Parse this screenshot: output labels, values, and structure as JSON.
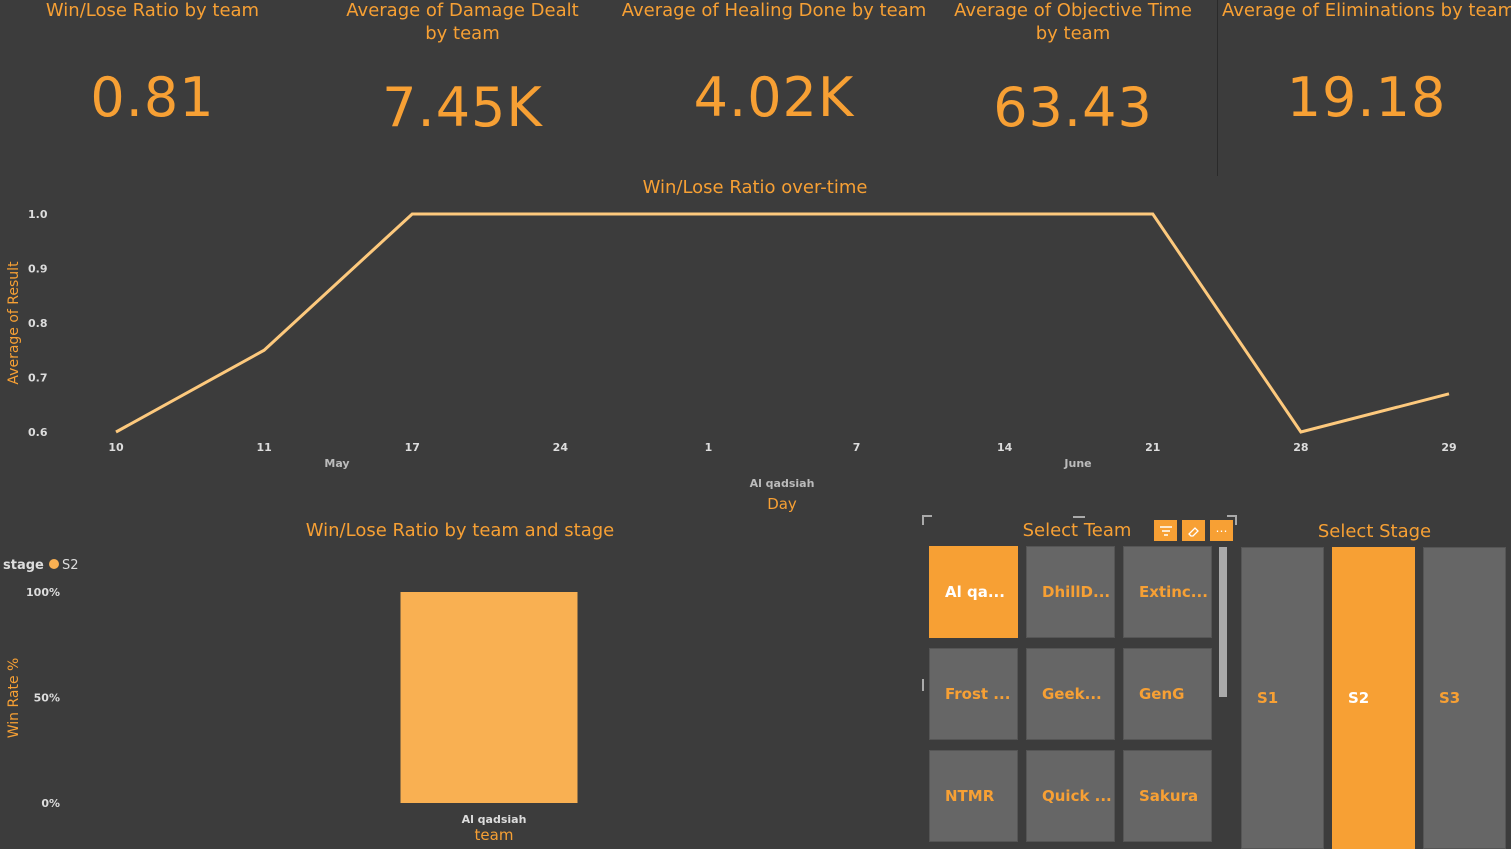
{
  "kpis": [
    {
      "title": "Win/Lose Ratio by team",
      "value": "0.81"
    },
    {
      "title": "Average of Damage Dealt by team",
      "value": "7.45K"
    },
    {
      "title": "Average of Healing Done by team",
      "value": "4.02K"
    },
    {
      "title": "Average of Objective Time by team",
      "value": "63.43"
    },
    {
      "title": "Average of Eliminations by team",
      "value": "19.18"
    }
  ],
  "line_chart": {
    "title": "Win/Lose Ratio over-time",
    "ylabel": "Average of Result",
    "xlabel": "Day",
    "sublabel": "Al qadsiah",
    "month_labels": [
      "May",
      "June"
    ]
  },
  "bar_chart": {
    "title": "Win/Lose Ratio by team and stage",
    "legend_title": "stage",
    "legend_item": "S2",
    "ylabel": "Win Rate %",
    "xlabel": "team",
    "category": "Al qadsiah"
  },
  "team_slicer": {
    "title": "Select Team",
    "tiles": [
      "Al qa...",
      "DhillD...",
      "Extinc...",
      "Frost ...",
      "Geek...",
      "GenG",
      "NTMR",
      "Quick ...",
      "Sakura"
    ],
    "selected": "Al qa..."
  },
  "stage_slicer": {
    "title": "Select Stage",
    "stages": [
      "S1",
      "S2",
      "S3"
    ],
    "selected": "S2"
  },
  "colors": {
    "accent": "#f7a034",
    "line": "#fdc97d",
    "bar": "#f9b052",
    "background": "#3c3c3c",
    "tile": "#666666"
  },
  "chart_data": [
    {
      "type": "line",
      "title": "Win/Lose Ratio over-time",
      "xlabel": "Day",
      "ylabel": "Average of Result",
      "x": [
        "10",
        "11",
        "17",
        "24",
        "1",
        "7",
        "14",
        "21",
        "28",
        "29"
      ],
      "values": [
        0.6,
        0.75,
        1.0,
        1.0,
        1.0,
        1.0,
        1.0,
        1.0,
        0.6,
        0.67
      ],
      "yticks": [
        "0.6",
        "0.7",
        "0.8",
        "0.9",
        "1.0"
      ],
      "ylim": [
        0.6,
        1.0
      ]
    },
    {
      "type": "bar",
      "title": "Win/Lose Ratio by team and stage",
      "xlabel": "team",
      "ylabel": "Win Rate %",
      "categories": [
        "Al qadsiah"
      ],
      "series": [
        {
          "name": "S2",
          "values": [
            100
          ]
        }
      ],
      "yticks": [
        "0%",
        "50%",
        "100%"
      ],
      "ylim": [
        0,
        100
      ]
    }
  ]
}
